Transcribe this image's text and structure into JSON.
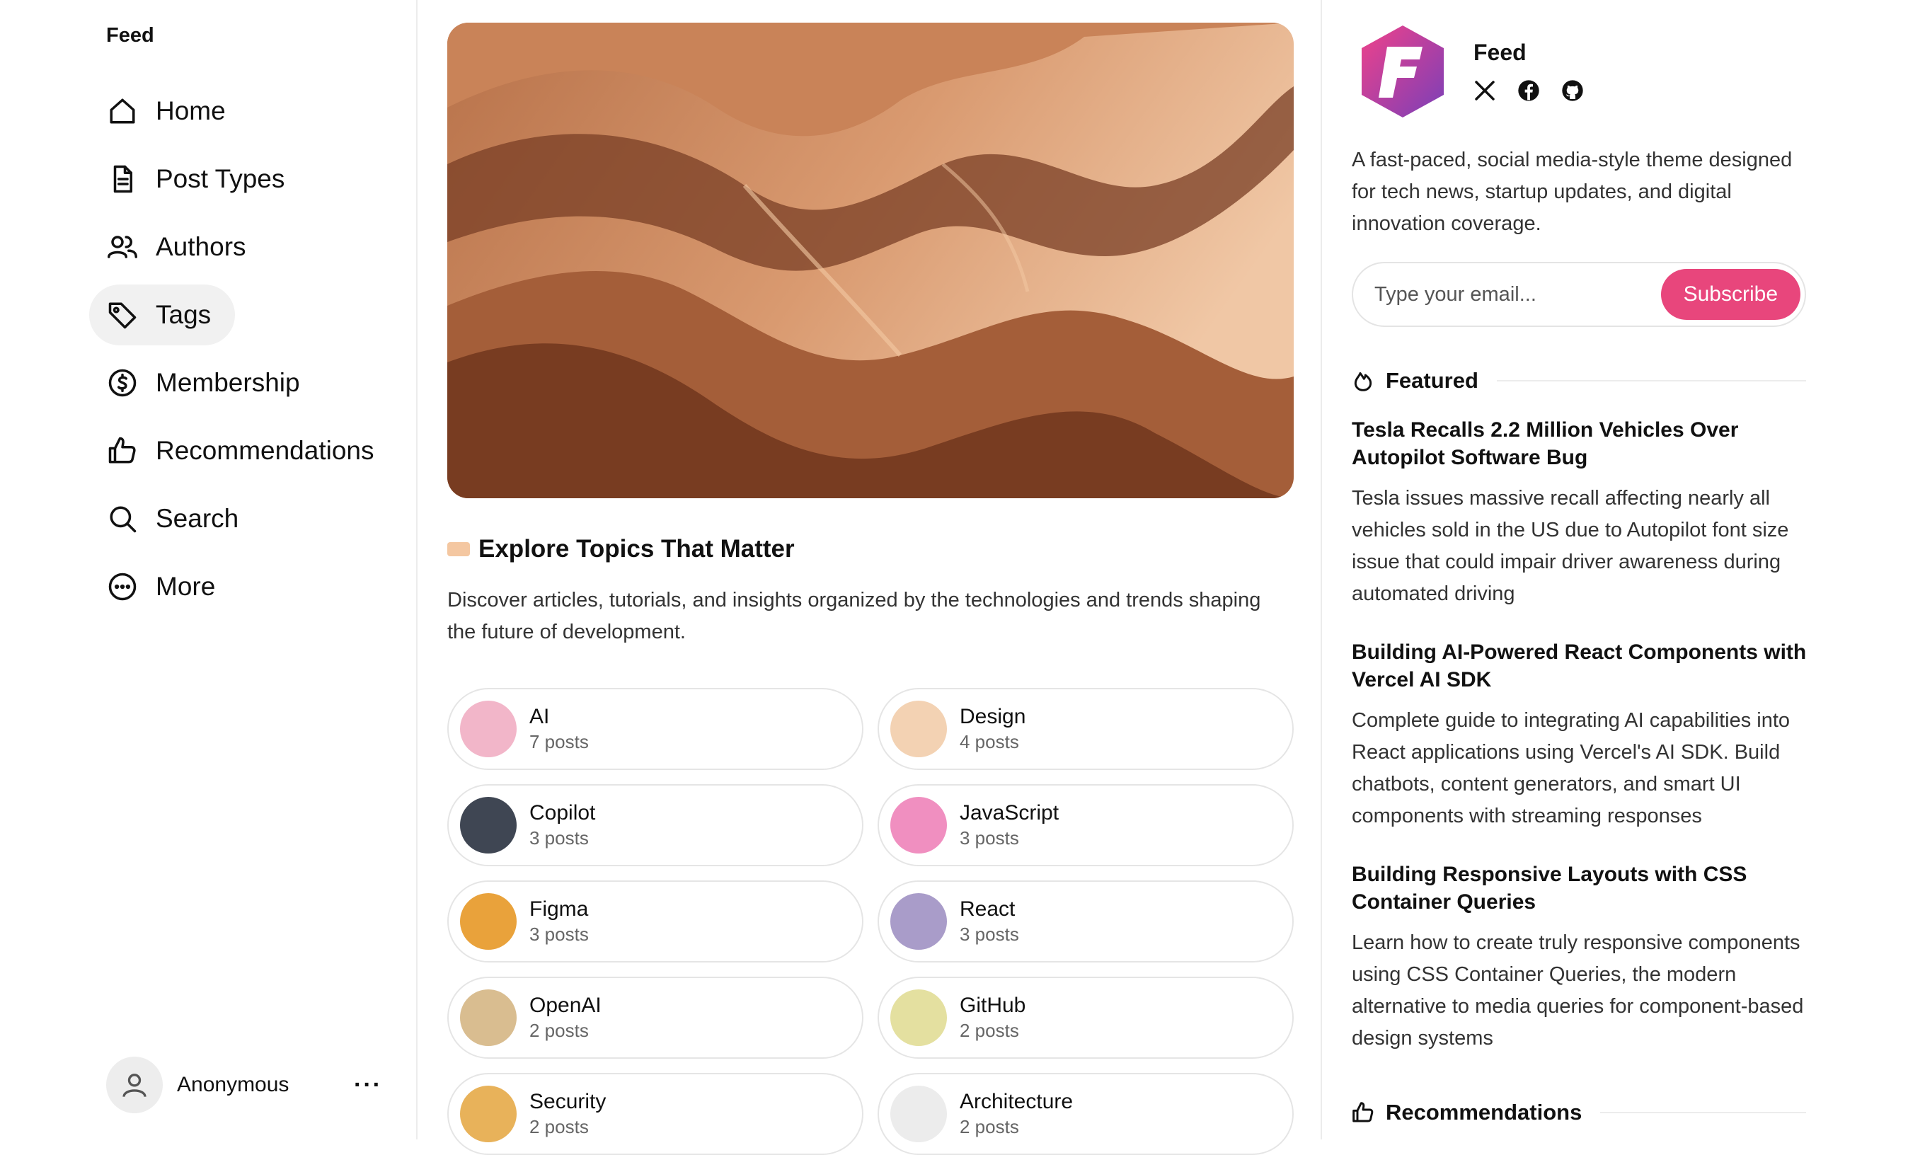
{
  "sidebar": {
    "brand": "Feed",
    "items": [
      {
        "label": "Home",
        "icon": "home-icon"
      },
      {
        "label": "Post Types",
        "icon": "document-icon"
      },
      {
        "label": "Authors",
        "icon": "users-icon"
      },
      {
        "label": "Tags",
        "icon": "tag-icon",
        "active": true
      },
      {
        "label": "Membership",
        "icon": "dollar-circle-icon"
      },
      {
        "label": "Recommendations",
        "icon": "thumbs-up-icon"
      },
      {
        "label": "Search",
        "icon": "search-icon"
      },
      {
        "label": "More",
        "icon": "more-circle-icon"
      }
    ],
    "user": {
      "name": "Anonymous",
      "menu": "···"
    }
  },
  "main": {
    "section_title": "Explore Topics That Matter",
    "section_desc": "Discover articles, tutorials, and insights organized by the technologies and trends shaping the future of development.",
    "tags": [
      {
        "name": "AI",
        "count": "7 posts",
        "color": "#f2b6c9"
      },
      {
        "name": "Design",
        "count": "4 posts",
        "color": "#f3d2b3"
      },
      {
        "name": "Copilot",
        "count": "3 posts",
        "color": "#3f4653"
      },
      {
        "name": "JavaScript",
        "count": "3 posts",
        "color": "#f08fc0"
      },
      {
        "name": "Figma",
        "count": "3 posts",
        "color": "#e9a23b"
      },
      {
        "name": "React",
        "count": "3 posts",
        "color": "#a99cc9"
      },
      {
        "name": "OpenAI",
        "count": "2 posts",
        "color": "#d9bd90"
      },
      {
        "name": "GitHub",
        "count": "2 posts",
        "color": "#e4e0a0"
      },
      {
        "name": "Security",
        "count": "2 posts",
        "color": "#e8b25a"
      },
      {
        "name": "Architecture",
        "count": "2 posts",
        "color": "#ececec"
      }
    ]
  },
  "right": {
    "site_name": "Feed",
    "socials": [
      "x-icon",
      "facebook-icon",
      "github-icon"
    ],
    "description": "A fast-paced, social media-style theme designed for tech news, startup updates, and digital innovation coverage.",
    "email_placeholder": "Type your email...",
    "subscribe_label": "Subscribe",
    "accent": "#e8467c",
    "featured_label": "Featured",
    "featured": [
      {
        "title": "Tesla Recalls 2.2 Million Vehicles Over Autopilot Software Bug",
        "excerpt": "Tesla issues massive recall affecting nearly all vehicles sold in the US due to Autopilot font size issue that could impair driver awareness during automated driving"
      },
      {
        "title": "Building AI-Powered React Components with Vercel AI SDK",
        "excerpt": "Complete guide to integrating AI capabilities into React applications using Vercel's AI SDK. Build chatbots, content generators, and smart UI components with streaming responses"
      },
      {
        "title": "Building Responsive Layouts with CSS Container Queries",
        "excerpt": "Learn how to create truly responsive components using CSS Container Queries, the modern alternative to media queries for component-based design systems"
      }
    ],
    "recommendations_label": "Recommendations"
  }
}
